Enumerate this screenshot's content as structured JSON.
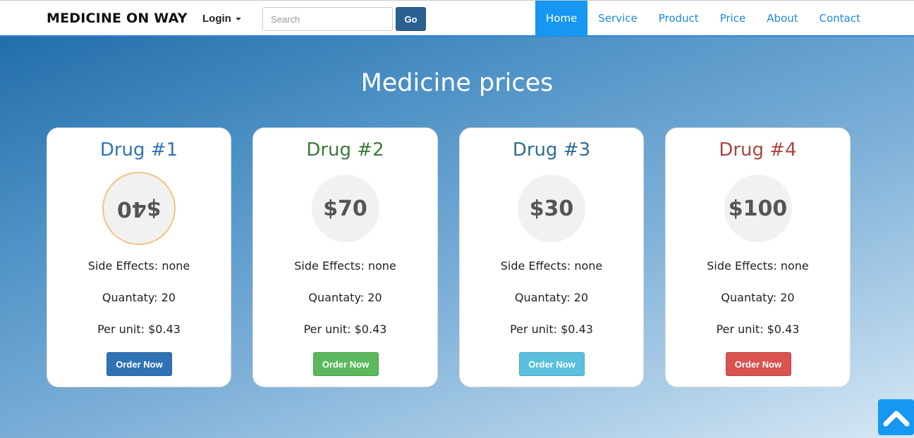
{
  "navbar": {
    "brand": "MEDICINE ON WAY",
    "login_label": "Login",
    "search": {
      "placeholder": "Search",
      "value": ""
    },
    "go_label": "Go",
    "links": [
      {
        "label": "Home",
        "active": true
      },
      {
        "label": "Service",
        "active": false
      },
      {
        "label": "Product",
        "active": false
      },
      {
        "label": "Price",
        "active": false
      },
      {
        "label": "About",
        "active": false
      },
      {
        "label": "Contact",
        "active": false
      }
    ],
    "accent_color": "#1597f2"
  },
  "main": {
    "title": "Medicine prices",
    "cards": [
      {
        "name": "Drug #1",
        "price": "$40",
        "side_effects": "Side Effects: none",
        "quantity": "Quantaty: 20",
        "per_unit": "Per unit: $0.43",
        "button": "Order Now",
        "title_color": "#3274b1",
        "button_color": "#3073b5"
      },
      {
        "name": "Drug #2",
        "price": "$70",
        "side_effects": "Side Effects: none",
        "quantity": "Quantaty: 20",
        "per_unit": "Per unit: $0.43",
        "button": "Order Now",
        "title_color": "#3d7a3c",
        "button_color": "#5cb85c"
      },
      {
        "name": "Drug #3",
        "price": "$30",
        "side_effects": "Side Effects: none",
        "quantity": "Quantaty: 20",
        "per_unit": "Per unit: $0.43",
        "button": "Order Now",
        "title_color": "#316d90",
        "button_color": "#5bc0de"
      },
      {
        "name": "Drug #4",
        "price": "$100",
        "side_effects": "Side Effects: none",
        "quantity": "Quantaty: 20",
        "per_unit": "Per unit: $0.43",
        "button": "Order Now",
        "title_color": "#a94442",
        "button_color": "#d9534f"
      }
    ]
  },
  "scroll_top_icon": "chevron-up-icon"
}
